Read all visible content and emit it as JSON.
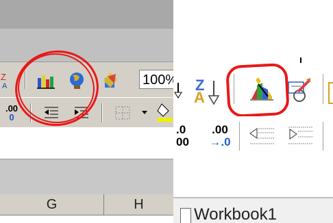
{
  "left_toolbar": {
    "zoom_value": "100%",
    "decimal_label": ".00",
    "decimal_subscript": "0"
  },
  "left_grid": {
    "columns": [
      "G",
      "H"
    ]
  },
  "right_toolbar": {
    "sort_top": "Z",
    "sort_bottom": "A",
    "dec_increase_top": ".0",
    "dec_increase_bottom": "00",
    "dec_decrease_top": ".00",
    "dec_decrease_bottom": "→.0"
  },
  "right_workbook": {
    "title": "Workbook1"
  },
  "colors": {
    "highlight": "#e81818",
    "toolbar_gray": "#d4d0c8",
    "title_bar_gray": "#c8c8c8"
  }
}
